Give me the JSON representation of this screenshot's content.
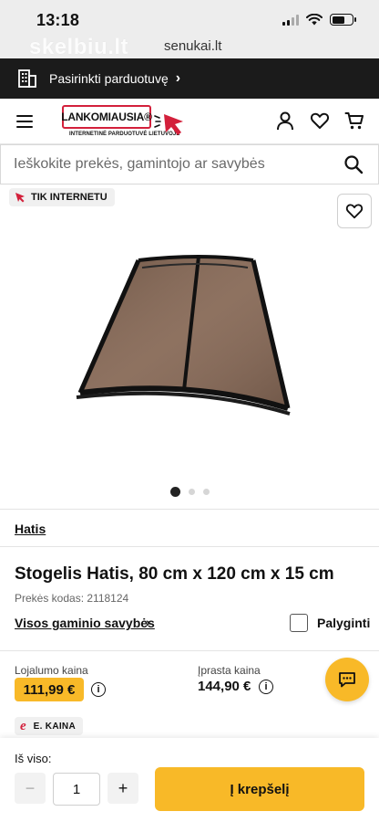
{
  "status_bar": {
    "time": "13:18"
  },
  "watermark": {
    "text": "skelbiu.lt",
    "url": "senukai.lt"
  },
  "store_bar": {
    "label": "Pasirinkti parduotuvę",
    "chevron": "›"
  },
  "header": {
    "logo_text": "LANKOMIAUSIA®",
    "logo_sub": "INTERNETINĖ PARDUOTUVĖ LIETUVOJE",
    "icons": [
      "menu-icon",
      "user-icon",
      "heart-icon",
      "cart-icon"
    ]
  },
  "search": {
    "placeholder": "Ieškokite prekės, gamintojo ar savybės"
  },
  "product": {
    "badge": "TIK INTERNETU",
    "brand": "Hatis",
    "title": "Stogelis Hatis, 80 cm x 120 cm x 15 cm",
    "code": "Prekės kodas: 2118124",
    "features_link": "Visos gaminio savybės",
    "compare_label": "Palyginti",
    "gallery": {
      "count": 3,
      "active": 1
    }
  },
  "prices": {
    "loyalty_label": "Lojalumo kaina",
    "loyalty_price": "111,99 €",
    "regular_label": "Įprasta kaina",
    "regular_price": "144,90 €",
    "eprice_label": "E. KAINA",
    "eprice_symbol": "e"
  },
  "bottom": {
    "total_label": "Iš viso:",
    "quantity": "1",
    "minus": "−",
    "plus": "+",
    "cart_button": "Į krepšelį"
  },
  "colors": {
    "accent": "#f8b928",
    "brand_red": "#d3203b",
    "dark": "#1b1b1b"
  }
}
